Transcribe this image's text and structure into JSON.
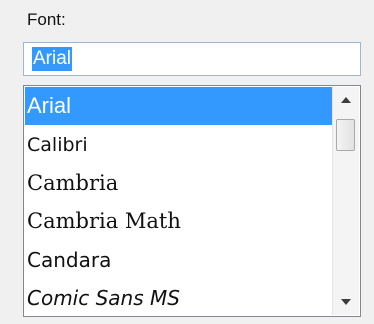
{
  "label": "Font:",
  "font_input": {
    "value": "Arial"
  },
  "font_list": {
    "selected_index": 0,
    "items": [
      {
        "label": "Arial"
      },
      {
        "label": "Calibri"
      },
      {
        "label": "Cambria"
      },
      {
        "label": "Cambria Math"
      },
      {
        "label": "Candara"
      },
      {
        "label": "Comic Sans MS"
      }
    ]
  },
  "icons": {
    "scroll_up": "triangle-up-icon",
    "scroll_down": "triangle-down-icon"
  },
  "colors": {
    "selection": "#3399ff",
    "selection_text": "#ffffff",
    "background": "#f0f0f0"
  }
}
